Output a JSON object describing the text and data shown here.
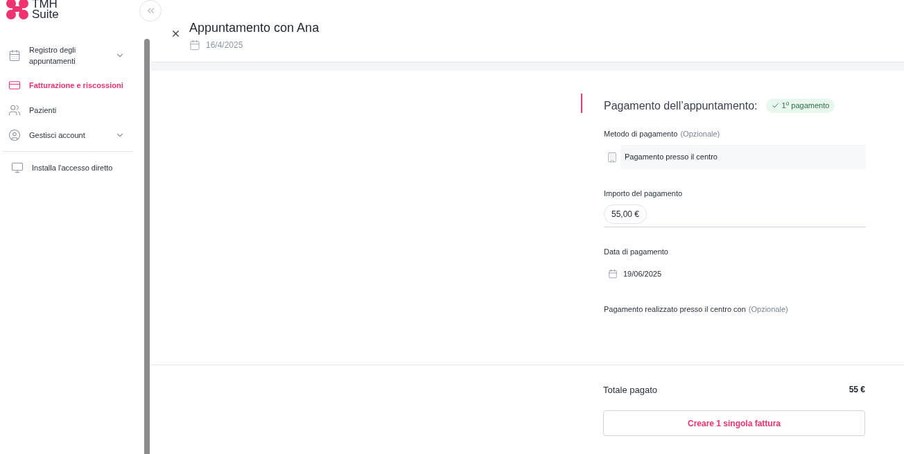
{
  "logo": {
    "line_1": "TMH",
    "line_2": "Suite"
  },
  "sidebar": {
    "items": [
      {
        "kind": "calendar",
        "label": "Registro degli appuntamenti",
        "selected": false,
        "expandable": true
      },
      {
        "kind": "card",
        "label": "Fatturazione e riscossioni",
        "selected": true,
        "expandable": false
      },
      {
        "kind": "people",
        "label": "Pazienti",
        "selected": false,
        "expandable": false
      },
      {
        "kind": "account",
        "label": "Gestisci account",
        "selected": false,
        "expandable": true
      }
    ],
    "bottom_items": [
      {
        "kind": "monitor",
        "label": "Installa l'accesso diretto",
        "selected": false
      }
    ]
  },
  "header": {
    "title": "Appuntamento con Ana",
    "date": "16/4/2025"
  },
  "payment": {
    "title": "Pagamento dell’appuntamento:",
    "badge": "1$^{o}$ pagamento",
    "method_label": "Metodo di pagamento",
    "method_optional": "(Opzionale)",
    "method_value": "Pagamento presso il centro",
    "amount_label": "Importo del pagamento",
    "amount_value": "55,00 €",
    "date_label": "Data di pagamento",
    "date_value": "19/06/2025",
    "center_label": "Pagamento realizzato presso il centro con",
    "center_optional": "(Opzionale)"
  },
  "footer": {
    "total_label": "Totale pagato",
    "total_value": "55 €",
    "button": "Creare 1 singola fattura"
  }
}
